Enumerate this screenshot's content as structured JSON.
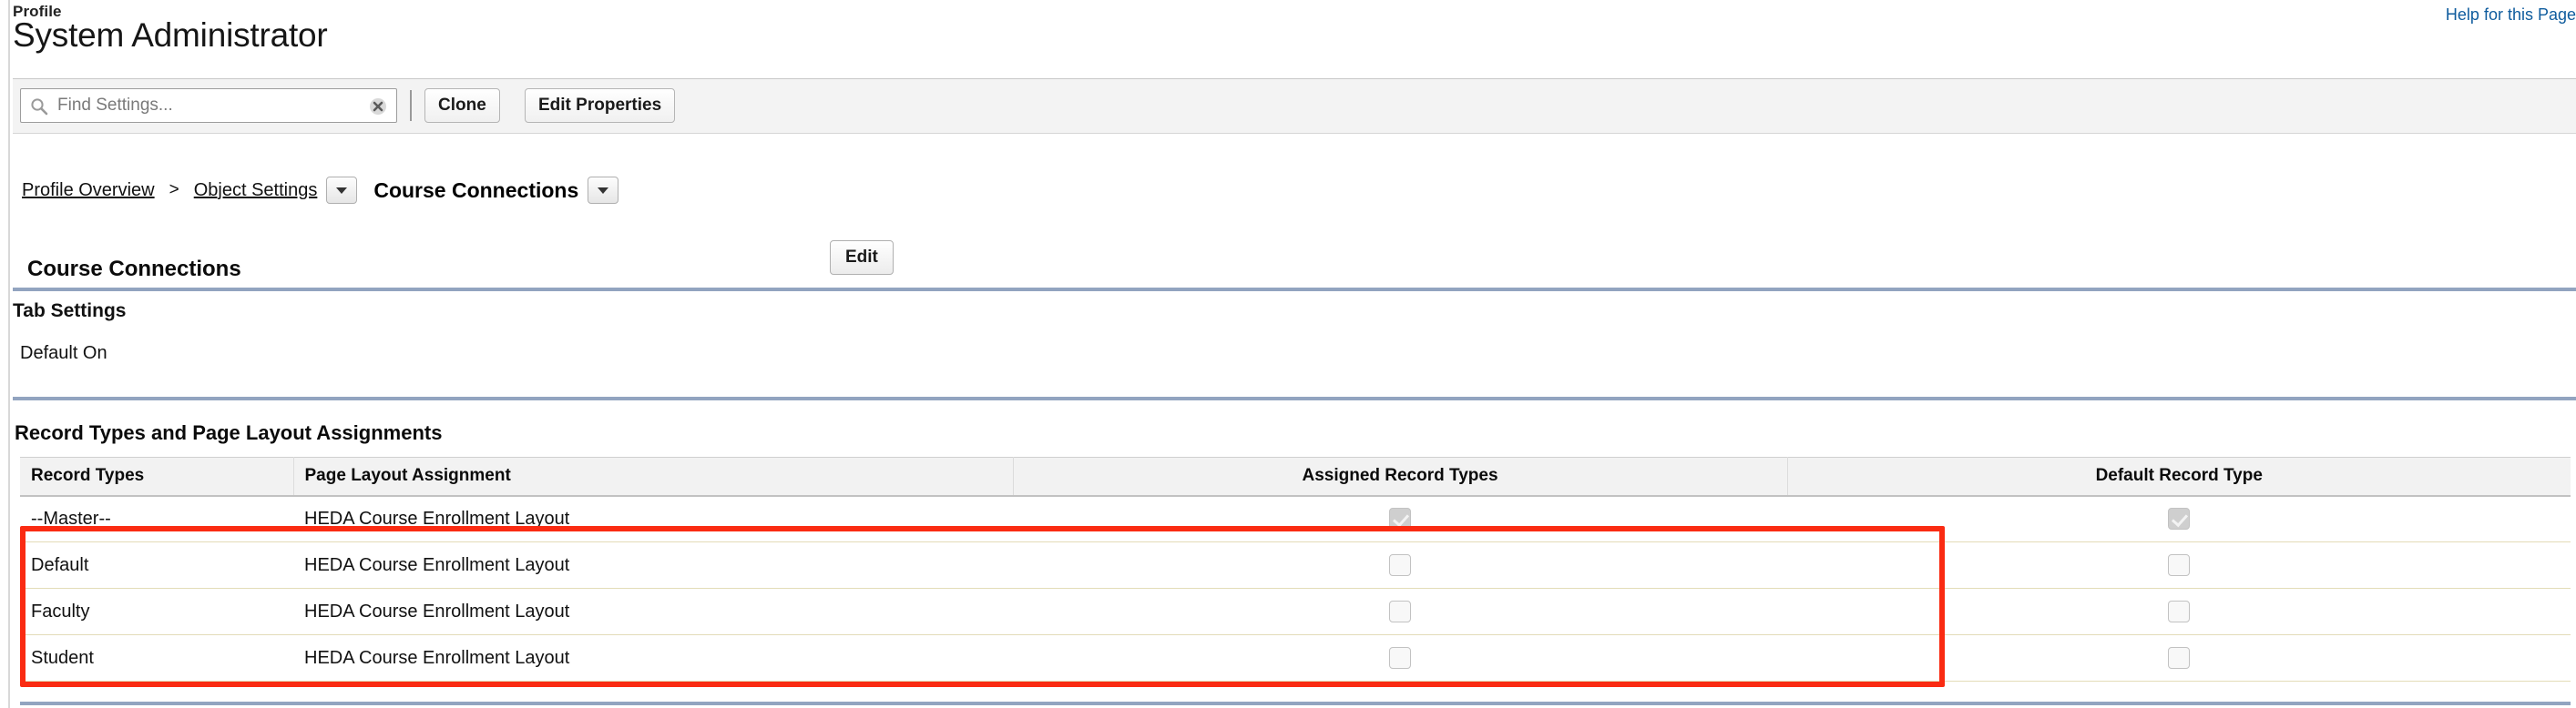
{
  "header": {
    "eyebrow": "Profile",
    "title": "System Administrator",
    "help_link": "Help for this Page"
  },
  "toolbar": {
    "search_placeholder": "Find Settings...",
    "search_value": "",
    "search_icon": "search-icon",
    "clear_icon": "clear-x-icon",
    "clone_label": "Clone",
    "edit_properties_label": "Edit Properties"
  },
  "breadcrumb": {
    "items": [
      {
        "label": "Profile Overview",
        "type": "link",
        "has_dropdown": false
      },
      {
        "label": "Object Settings",
        "type": "link",
        "has_dropdown": true
      }
    ],
    "separator": ">",
    "current": {
      "label": "Course Connections",
      "has_dropdown": true
    }
  },
  "section_object": {
    "title": "Course Connections",
    "edit_label": "Edit"
  },
  "tab_settings": {
    "heading": "Tab Settings",
    "value": "Default On"
  },
  "record_types_section": {
    "heading": "Record Types and Page Layout Assignments",
    "columns": [
      "Record Types",
      "Page Layout Assignment",
      "Assigned Record Types",
      "Default Record Type"
    ],
    "rows": [
      {
        "record_type": "--Master--",
        "page_layout": "HEDA Course Enrollment Layout",
        "assigned": true,
        "assigned_disabled": true,
        "default": true,
        "default_disabled": true
      },
      {
        "record_type": "Default",
        "page_layout": "HEDA Course Enrollment Layout",
        "assigned": false,
        "assigned_disabled": false,
        "default": false,
        "default_disabled": false
      },
      {
        "record_type": "Faculty",
        "page_layout": "HEDA Course Enrollment Layout",
        "assigned": false,
        "assigned_disabled": false,
        "default": false,
        "default_disabled": false
      },
      {
        "record_type": "Student",
        "page_layout": "HEDA Course Enrollment Layout",
        "assigned": false,
        "assigned_disabled": false,
        "default": false,
        "default_disabled": false
      }
    ]
  },
  "annotation": {
    "highlight_color": "#fa2b12",
    "covers_rows": [
      "Default",
      "Faculty",
      "Student"
    ]
  }
}
